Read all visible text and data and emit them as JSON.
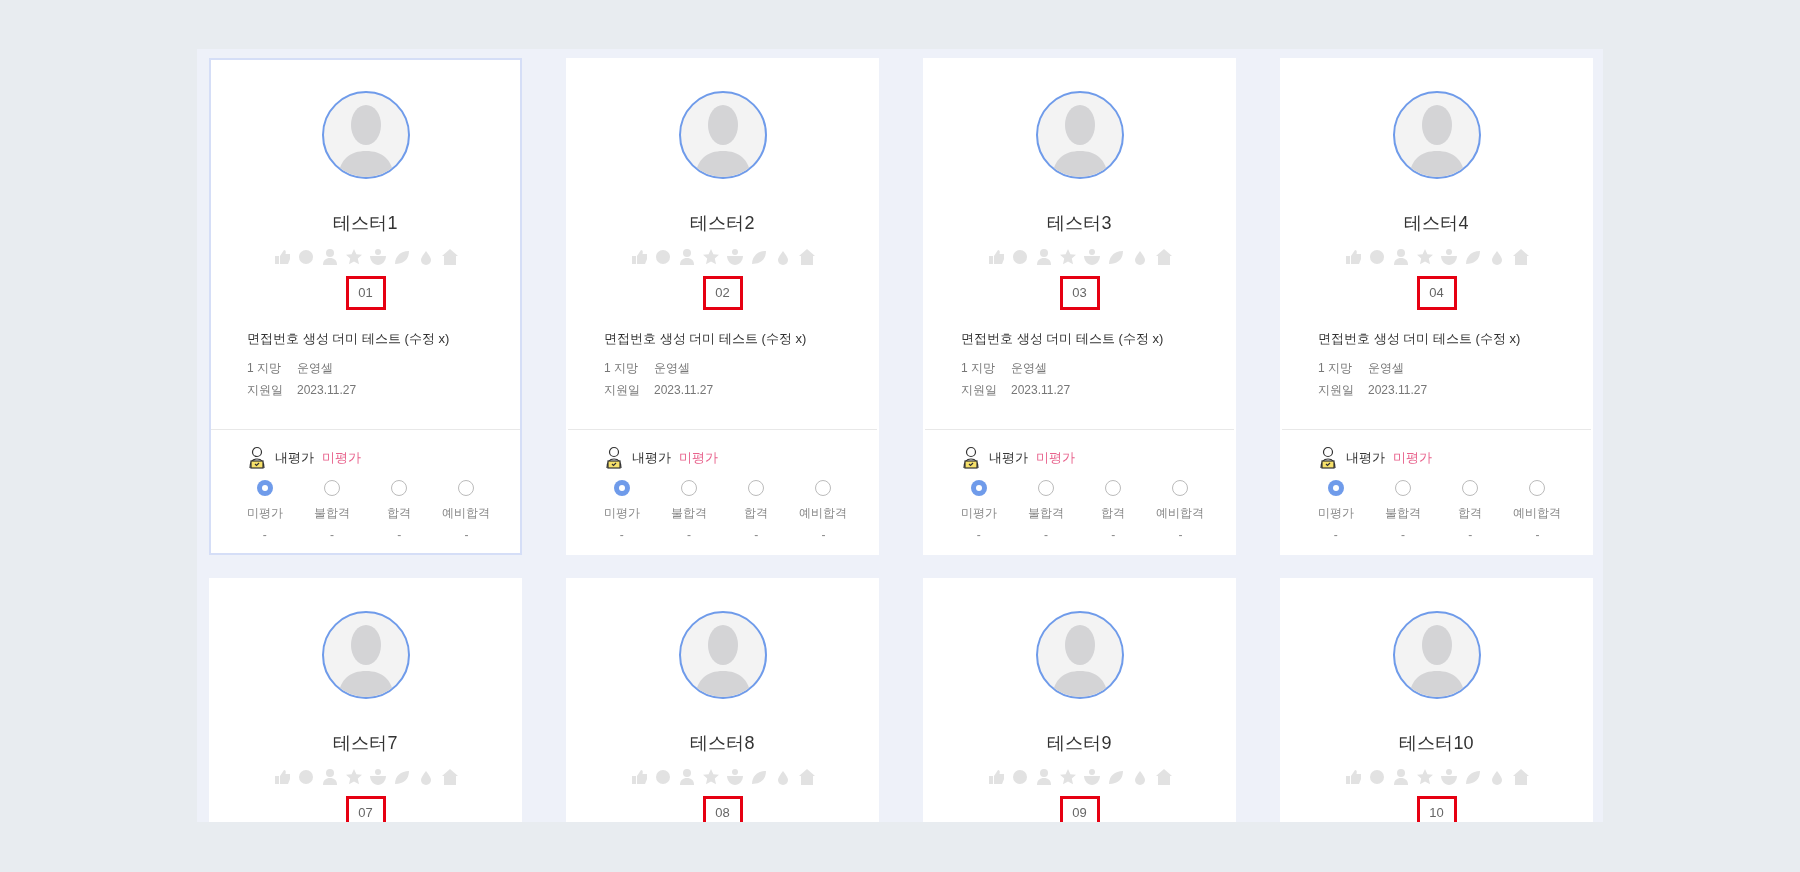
{
  "cards": [
    {
      "name": "테스터1",
      "number": "01",
      "marked": true,
      "selected": true,
      "title": "면접번호 생성 더미 테스트 (수정 x)",
      "info": [
        {
          "label": "1 지망",
          "value": "운영셀"
        },
        {
          "label": "지원일",
          "value": "2023.11.27"
        }
      ],
      "evaluation": {
        "label": "내평가",
        "status": "미평가",
        "options": [
          {
            "label": "미평가",
            "selected": true,
            "count": "-"
          },
          {
            "label": "불합격",
            "selected": false,
            "count": "-"
          },
          {
            "label": "합격",
            "selected": false,
            "count": "-"
          },
          {
            "label": "예비합격",
            "selected": false,
            "count": "-"
          }
        ]
      }
    },
    {
      "name": "테스터2",
      "number": "02",
      "marked": true,
      "selected": false,
      "title": "면접번호 생성 더미 테스트 (수정 x)",
      "info": [
        {
          "label": "1 지망",
          "value": "운영셀"
        },
        {
          "label": "지원일",
          "value": "2023.11.27"
        }
      ],
      "evaluation": {
        "label": "내평가",
        "status": "미평가",
        "options": [
          {
            "label": "미평가",
            "selected": true,
            "count": "-"
          },
          {
            "label": "불합격",
            "selected": false,
            "count": "-"
          },
          {
            "label": "합격",
            "selected": false,
            "count": "-"
          },
          {
            "label": "예비합격",
            "selected": false,
            "count": "-"
          }
        ]
      }
    },
    {
      "name": "테스터3",
      "number": "03",
      "marked": true,
      "selected": false,
      "title": "면접번호 생성 더미 테스트 (수정 x)",
      "info": [
        {
          "label": "1 지망",
          "value": "운영셀"
        },
        {
          "label": "지원일",
          "value": "2023.11.27"
        }
      ],
      "evaluation": {
        "label": "내평가",
        "status": "미평가",
        "options": [
          {
            "label": "미평가",
            "selected": true,
            "count": "-"
          },
          {
            "label": "불합격",
            "selected": false,
            "count": "-"
          },
          {
            "label": "합격",
            "selected": false,
            "count": "-"
          },
          {
            "label": "예비합격",
            "selected": false,
            "count": "-"
          }
        ]
      }
    },
    {
      "name": "테스터4",
      "number": "04",
      "marked": true,
      "selected": false,
      "title": "면접번호 생성 더미 테스트 (수정 x)",
      "info": [
        {
          "label": "1 지망",
          "value": "운영셀"
        },
        {
          "label": "지원일",
          "value": "2023.11.27"
        }
      ],
      "evaluation": {
        "label": "내평가",
        "status": "미평가",
        "options": [
          {
            "label": "미평가",
            "selected": true,
            "count": "-"
          },
          {
            "label": "불합격",
            "selected": false,
            "count": "-"
          },
          {
            "label": "합격",
            "selected": false,
            "count": "-"
          },
          {
            "label": "예비합격",
            "selected": false,
            "count": "-"
          }
        ]
      }
    },
    {
      "name": "테스터7",
      "number": "07",
      "marked": true,
      "selected": false
    },
    {
      "name": "테스터8",
      "number": "08",
      "marked": true,
      "selected": false
    },
    {
      "name": "테스터9",
      "number": "09",
      "marked": true,
      "selected": false
    },
    {
      "name": "테스터10",
      "number": "10",
      "marked": true,
      "selected": false
    }
  ]
}
